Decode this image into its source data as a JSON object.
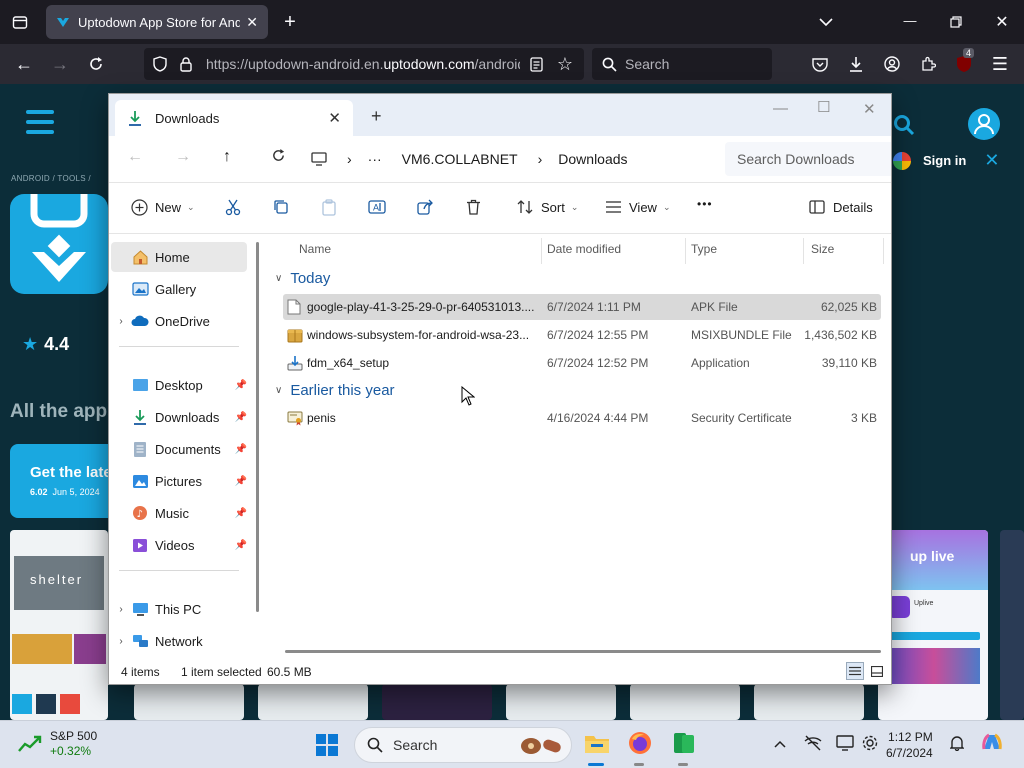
{
  "browser": {
    "tab_title": "Uptodown App Store for Android",
    "url_prefix": "https://uptodown-android.en.",
    "url_domain": "uptodown.com",
    "url_suffix": "/android",
    "search_placeholder": "Search",
    "extension_badge": "4"
  },
  "webpage": {
    "breadcrumb": "ANDROID  /  TOOLS  /",
    "rating": "4.4",
    "section_title": "All the apps",
    "latest_title": "Get the latest",
    "latest_version": "6.02",
    "latest_date": "Jun 5, 2024",
    "sign_in": "Sign in",
    "thumb_text": "shelter",
    "thumb_brand": "Uplive",
    "thumb_logo": "up live"
  },
  "explorer": {
    "tab_title": "Downloads",
    "breadcrumb": [
      "VM6.COLLABNET",
      "Downloads"
    ],
    "search_placeholder": "Search Downloads",
    "commands": {
      "new": "New",
      "sort": "Sort",
      "view": "View",
      "more": "•••",
      "details": "Details"
    },
    "nav": {
      "home": "Home",
      "gallery": "Gallery",
      "onedrive": "OneDrive",
      "desktop": "Desktop",
      "downloads": "Downloads",
      "documents": "Documents",
      "pictures": "Pictures",
      "music": "Music",
      "videos": "Videos",
      "thispc": "This PC",
      "network": "Network"
    },
    "columns": {
      "name": "Name",
      "date": "Date modified",
      "type": "Type",
      "size": "Size"
    },
    "groups": [
      {
        "label": "Today",
        "files": [
          {
            "name": "google-play-41-3-25-29-0-pr-640531013....",
            "date": "6/7/2024 1:11 PM",
            "type": "APK File",
            "size": "62,025 KB"
          },
          {
            "name": "windows-subsystem-for-android-wsa-23...",
            "date": "6/7/2024 12:55 PM",
            "type": "MSIXBUNDLE File",
            "size": "1,436,502 KB"
          },
          {
            "name": "fdm_x64_setup",
            "date": "6/7/2024 12:52 PM",
            "type": "Application",
            "size": "39,110 KB"
          }
        ]
      },
      {
        "label": "Earlier this year",
        "files": [
          {
            "name": "penis",
            "date": "4/16/2024 4:44 PM",
            "type": "Security Certificate",
            "size": "3 KB"
          }
        ]
      }
    ],
    "status": {
      "count": "4 items",
      "selected": "1 item selected",
      "size": "60.5 MB"
    }
  },
  "taskbar": {
    "stock_name": "S&P 500",
    "stock_change": "+0.32%",
    "search_placeholder": "Search",
    "time": "1:12 PM",
    "date": "6/7/2024"
  },
  "colors": {
    "accent": "#1aa8e0",
    "page_bg": "#0c2d39",
    "explorer_link": "#1a5aa0"
  }
}
